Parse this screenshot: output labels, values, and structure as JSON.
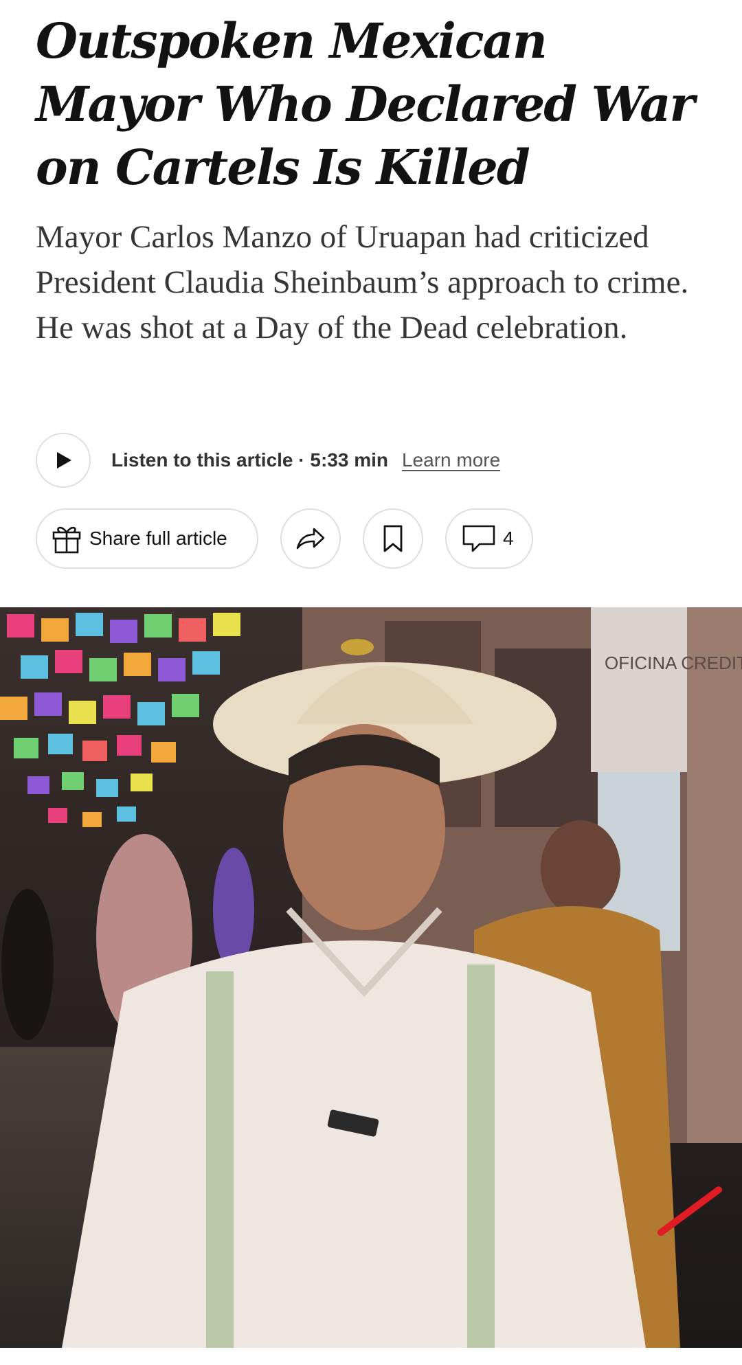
{
  "article": {
    "headline": "Outspoken Mexican Mayor Who Declared War on Cartels Is Killed",
    "summary": "Mayor Carlos Manzo of Uruapan had criticized President Claudia Sheinbaum’s approach to crime. He was shot at a Day of the Dead celebration."
  },
  "audio": {
    "listen_label": "Listen to this article · 5:33 min",
    "learn_more": "Learn more",
    "icon": "play-icon"
  },
  "actions": {
    "share_label": "Share full article",
    "share_icon": "gift-icon",
    "forward_icon": "share-arrow-icon",
    "bookmark_icon": "bookmark-icon",
    "comment_icon": "comment-icon",
    "comment_count": "4"
  },
  "photo": {
    "sign_text": "OFICINA CREDIT",
    "description_colors": {
      "night_street": "#2a2522",
      "shirt": "#efe6df",
      "hat": "#e8dcc4",
      "jacket": "#b27a30",
      "annotation_mark": "#e01b24"
    }
  }
}
